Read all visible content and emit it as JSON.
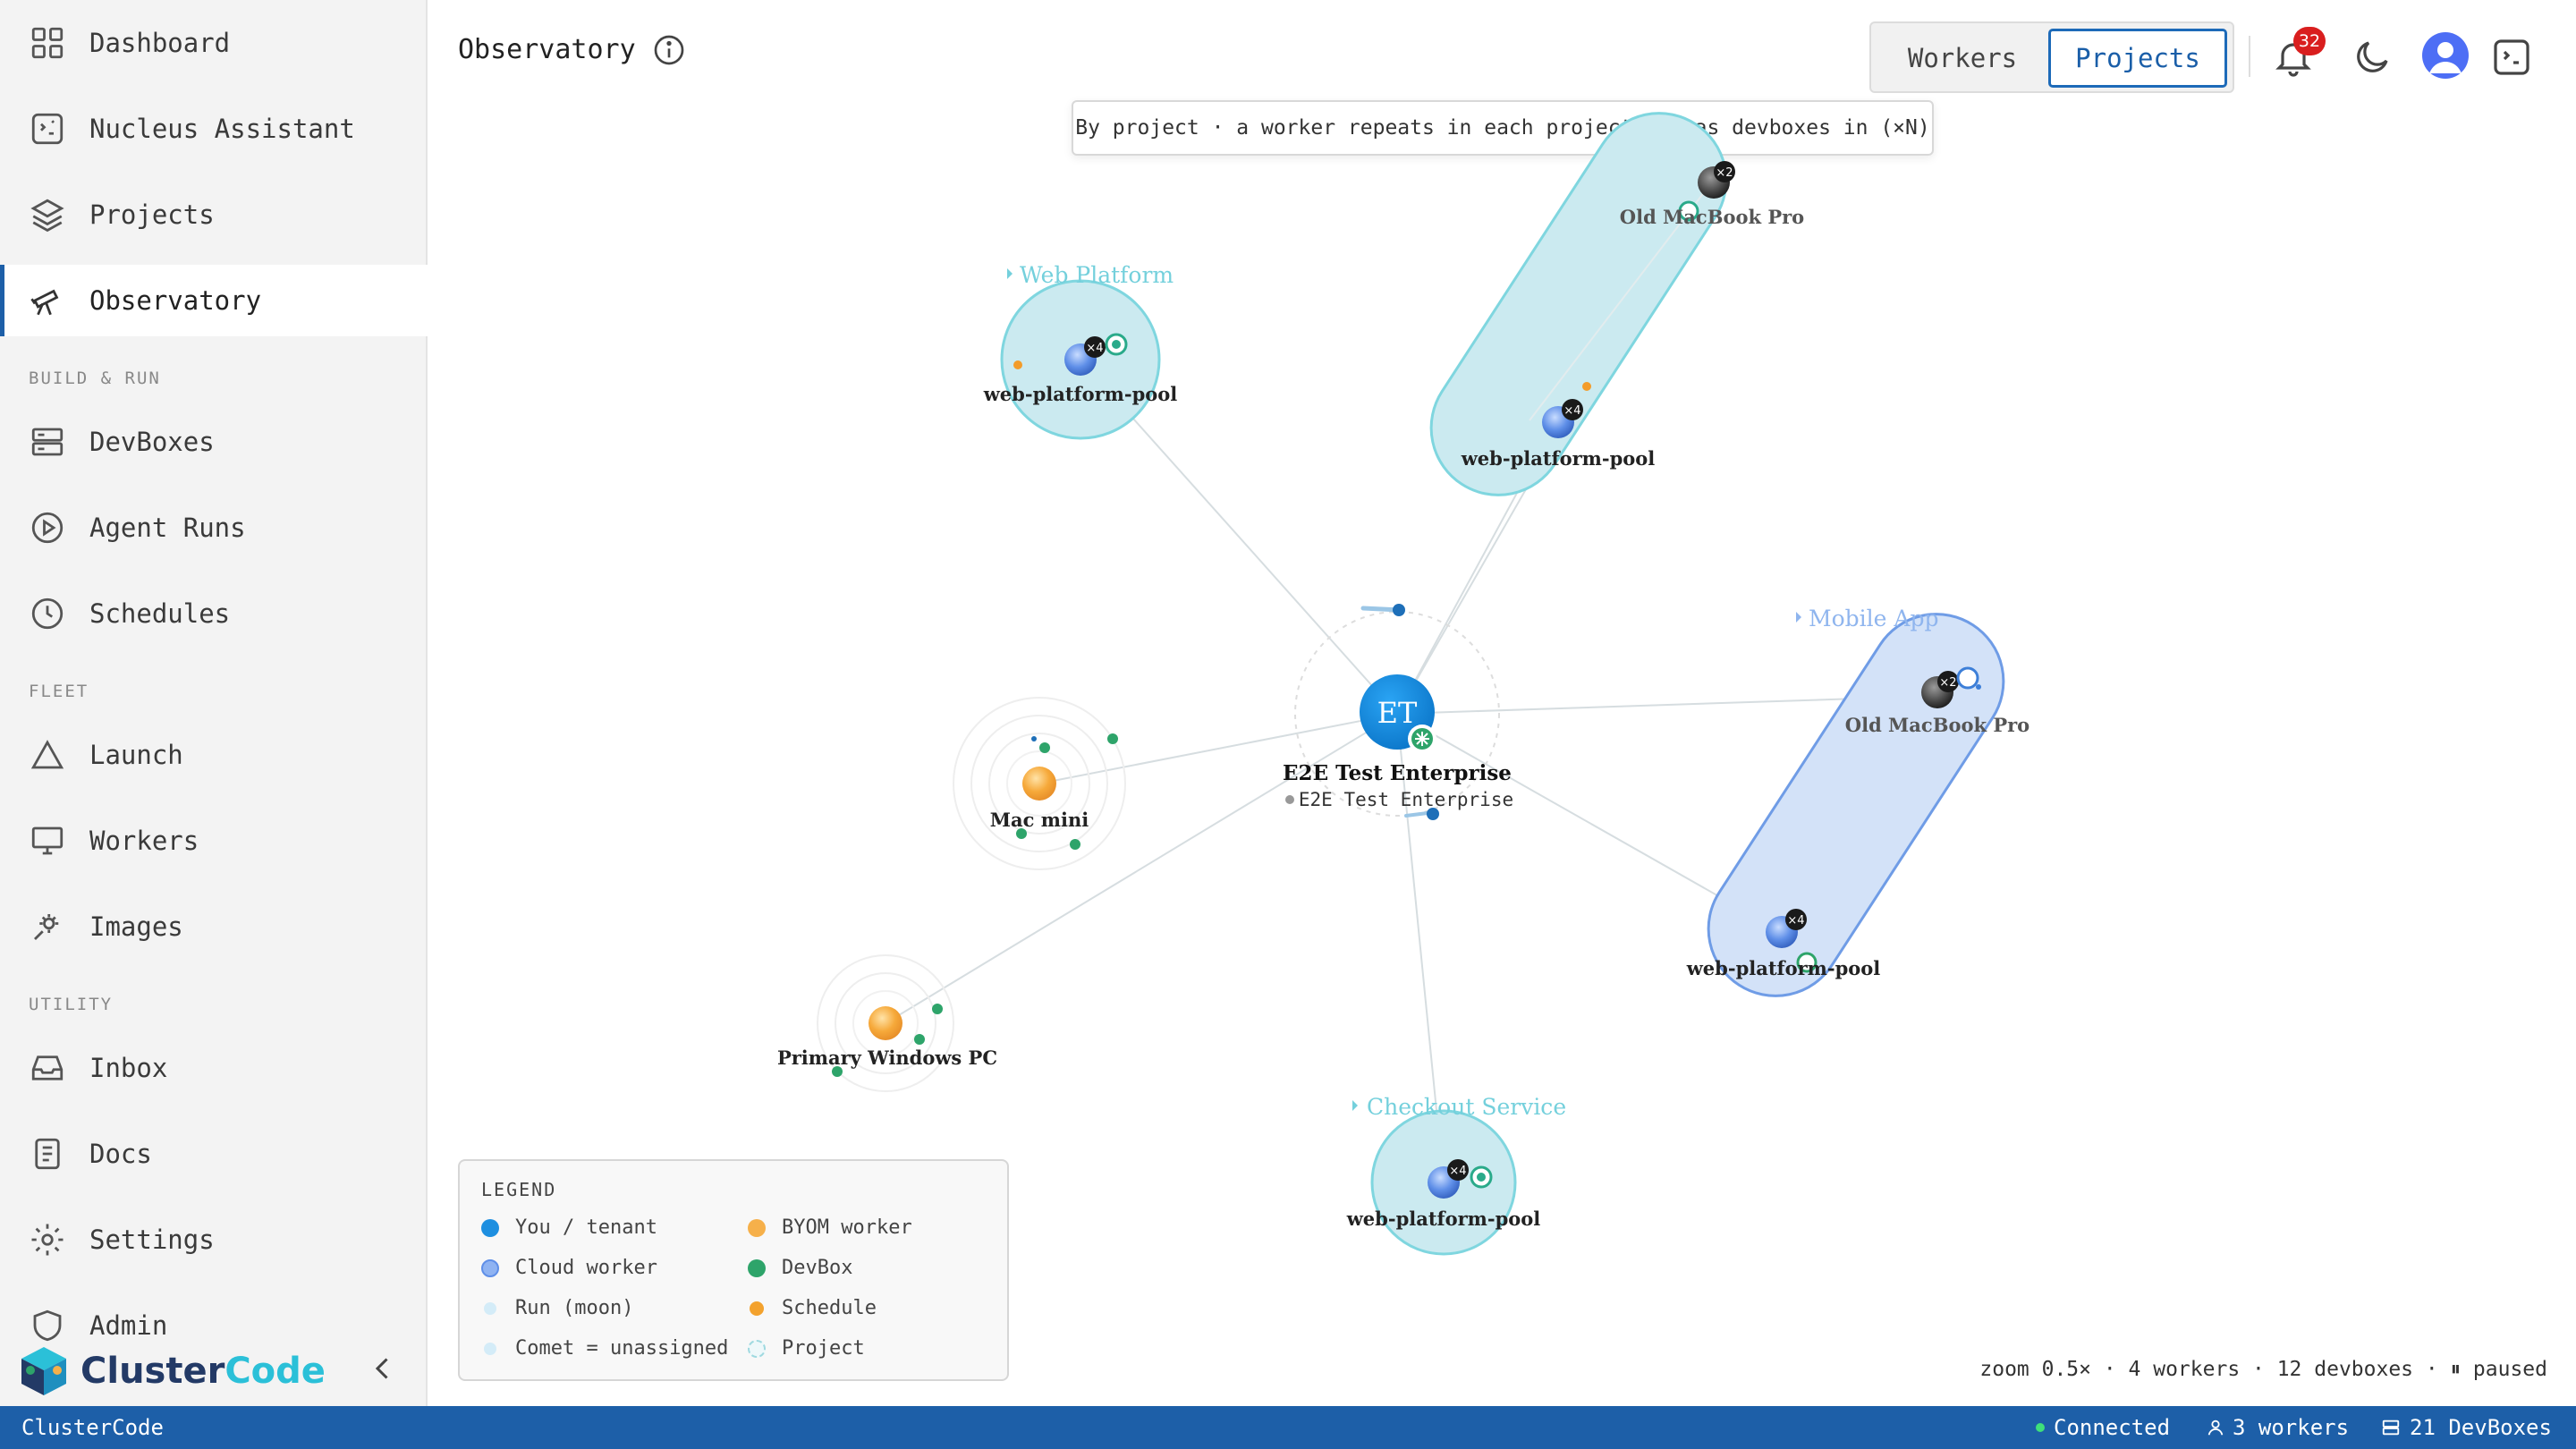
{
  "sidebar": {
    "items": [
      {
        "label": "Dashboard",
        "icon": "dashboard-icon"
      },
      {
        "label": "Nucleus Assistant",
        "icon": "assistant-icon"
      },
      {
        "label": "Projects",
        "icon": "layers-icon"
      },
      {
        "label": "Observatory",
        "icon": "telescope-icon",
        "active": true
      },
      {
        "label": "DevBoxes",
        "icon": "server-icon"
      },
      {
        "label": "Agent Runs",
        "icon": "play-circle-icon"
      },
      {
        "label": "Schedules",
        "icon": "clock-icon"
      },
      {
        "label": "Launch",
        "icon": "triangle-icon"
      },
      {
        "label": "Workers",
        "icon": "monitor-icon"
      },
      {
        "label": "Images",
        "icon": "image-gear-icon"
      },
      {
        "label": "Inbox",
        "icon": "inbox-icon"
      },
      {
        "label": "Docs",
        "icon": "document-icon"
      },
      {
        "label": "Settings",
        "icon": "gear-icon"
      },
      {
        "label": "Admin",
        "icon": "shield-icon"
      }
    ],
    "sections": {
      "build_run": "BUILD & RUN",
      "fleet": "FLEET",
      "utility": "UTILITY"
    },
    "brand": {
      "part1": "Cluster",
      "part2": "Code"
    }
  },
  "header": {
    "title": "Observatory",
    "view_toggle": {
      "workers": "Workers",
      "projects": "Projects",
      "selected": "Projects"
    },
    "notifications_count": "32"
  },
  "hint": "By project · a worker repeats in each project it has devboxes in (×N)",
  "graph": {
    "center": {
      "initials": "ET",
      "name": "E2E Test Enterprise",
      "subtitle": "E2E Test Enterprise"
    },
    "projects": [
      {
        "name": "Web Platform",
        "pool": "web-platform-pool",
        "count": "×4"
      },
      {
        "name": "Mobile App",
        "pool": "web-platform-pool",
        "count": "×4",
        "worker": "Old MacBook Pro",
        "worker_count": "×2"
      },
      {
        "name": "Checkout Service",
        "pool": "web-platform-pool",
        "count": "×4"
      },
      {
        "name": "",
        "pool": "web-platform-pool",
        "count": "×4",
        "worker": "Old MacBook Pro",
        "worker_count": "×2"
      }
    ],
    "unassigned_workers": [
      {
        "name": "Mac mini"
      },
      {
        "name": "Primary Windows PC"
      }
    ]
  },
  "legend": {
    "title": "LEGEND",
    "items": [
      {
        "label": "You / tenant",
        "color": "#1e8fe0"
      },
      {
        "label": "BYOM worker",
        "color": "#f6b04a"
      },
      {
        "label": "Cloud worker",
        "color": "#6a9cf0"
      },
      {
        "label": "DevBox",
        "color": "#2ea46a"
      },
      {
        "label": "Run (moon)",
        "color": "#d4ecf8"
      },
      {
        "label": "Schedule",
        "color": "#f3a22e"
      },
      {
        "label": "Comet = unassigned",
        "color": "#d4ecf8"
      },
      {
        "label": "Project",
        "color": "#cfe9ee"
      }
    ]
  },
  "stats": "zoom 0.5× · 4 workers · 12 devboxes · ⏸ paused",
  "statusbar": {
    "app": "ClusterCode",
    "connection": "Connected",
    "workers": "3 workers",
    "devboxes": "21 DevBoxes"
  }
}
